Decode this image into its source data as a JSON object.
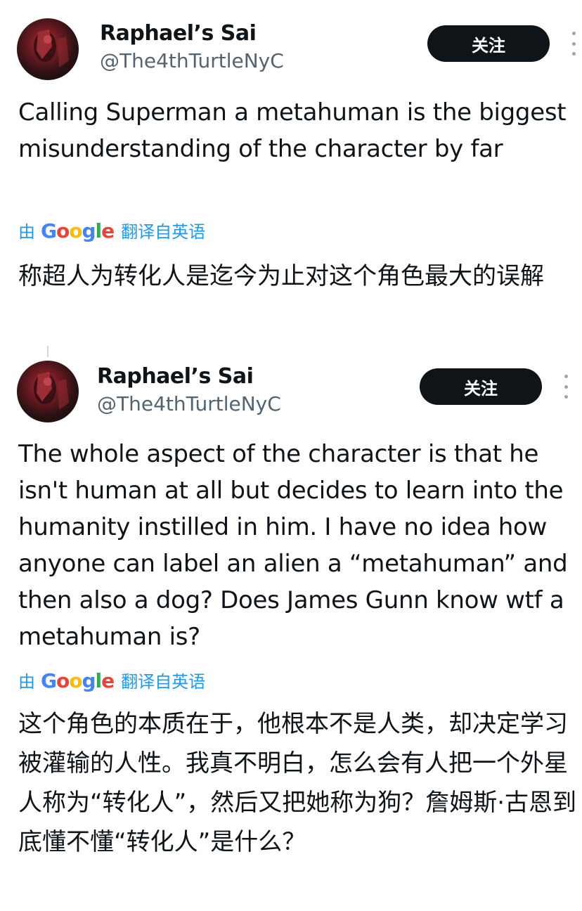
{
  "tweets": [
    {
      "author": "Raphael’s Sai",
      "handle": "@The4thTurtleNyC",
      "follow_label": "关注",
      "text": "Calling Superman a metahuman is the biggest misunderstanding of the character by far",
      "translate_prefix": "由",
      "translate_brand": [
        "G",
        "o",
        "o",
        "g",
        "l",
        "e"
      ],
      "translate_suffix": "翻译自英语",
      "translation": "称超人为转化人是迄今为止对这个角色最大的误解"
    },
    {
      "author": "Raphael’s Sai",
      "handle": "@The4thTurtleNyC",
      "follow_label": "关注",
      "text": "The whole aspect of the character is that he isn't human at all but decides to learn into the humanity instilled in him. I have no idea how anyone can label an alien a “metahuman” and then also a dog? Does James Gunn know wtf a metahuman is?",
      "translate_prefix": "由",
      "translate_brand": [
        "G",
        "o",
        "o",
        "g",
        "l",
        "e"
      ],
      "translate_suffix": "翻译自英语",
      "translation": "这个角色的本质在于，他根本不是人类，却决定学习被灌输的人性。我真不明白，怎么会有人把一个外星人称为“转化人”，然后又把她称为狗？詹姆斯·古恩到底懂不懂“转化人”是什么？"
    }
  ],
  "colors": {
    "text": "#0f1419",
    "secondary": "#536471",
    "link": "#1d9bf0",
    "button_bg": "#0f1419",
    "button_text": "#ffffff"
  },
  "icons": {
    "more": "more-vertical-icon",
    "avatar": "user-avatar-image"
  }
}
